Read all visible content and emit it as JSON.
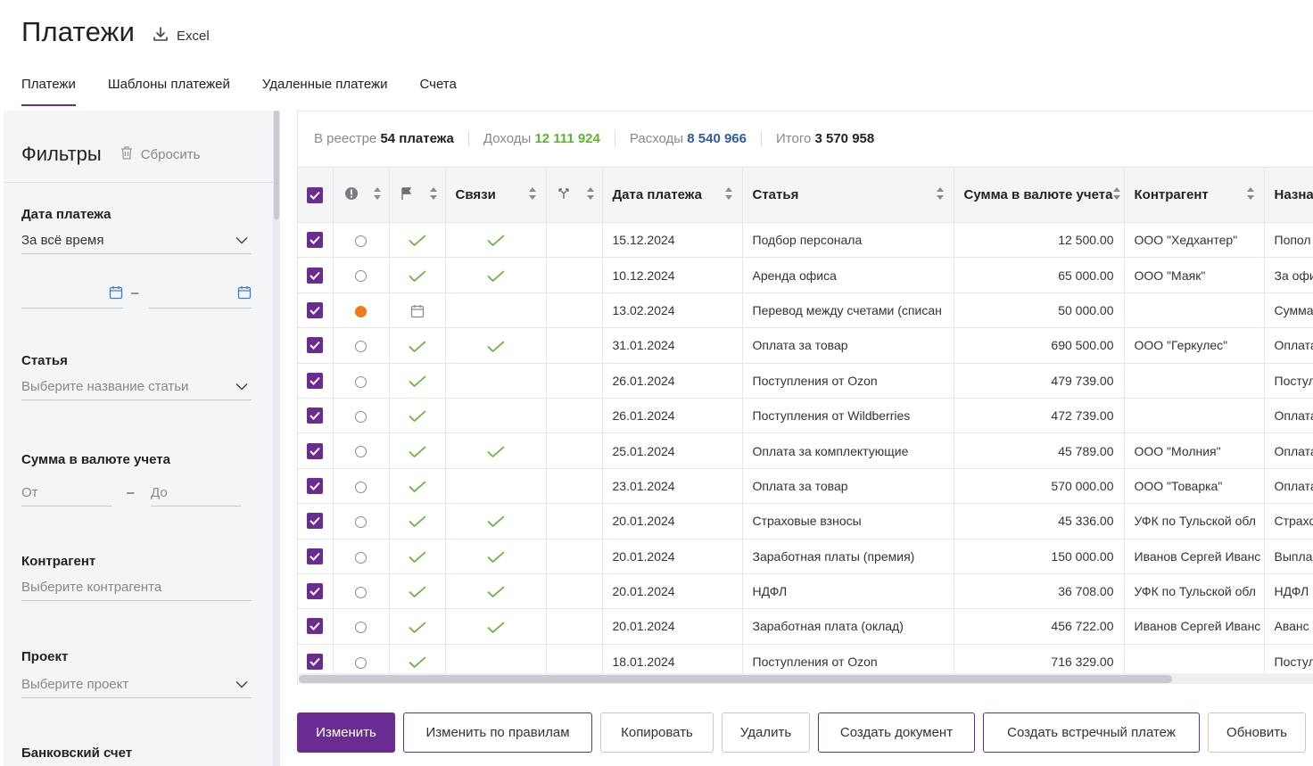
{
  "header": {
    "title": "Платежи",
    "excel_label": "Excel"
  },
  "tabs": [
    {
      "label": "Платежи",
      "active": true
    },
    {
      "label": "Шаблоны платежей",
      "active": false
    },
    {
      "label": "Удаленные платежи",
      "active": false
    },
    {
      "label": "Счета",
      "active": false
    }
  ],
  "filters": {
    "title": "Фильтры",
    "reset_label": "Сбросить",
    "date_label": "Дата платежа",
    "date_select": "За всё время",
    "date_dash": "–",
    "article_label": "Статья",
    "article_placeholder": "Выберите название статьи",
    "amount_label": "Сумма в валюте учета",
    "amount_from": "От",
    "amount_dash": "–",
    "amount_to": "До",
    "counterparty_label": "Контрагент",
    "counterparty_placeholder": "Выберите контрагента",
    "project_label": "Проект",
    "project_placeholder": "Выберите проект",
    "bank_label": "Банковский счет"
  },
  "summary": {
    "registry_label": "В реестре",
    "registry_value": "54 платежа",
    "income_label": "Доходы",
    "income_value": "12 111 924",
    "expense_label": "Расходы",
    "expense_value": "8 540 966",
    "total_label": "Итого",
    "total_value": "3 570 958"
  },
  "table": {
    "columns": {
      "links": "Связи",
      "date": "Дата платежа",
      "article": "Статья",
      "amount": "Сумма в валюте учета",
      "counterparty": "Контрагент",
      "purpose": "Назна"
    },
    "rows": [
      {
        "status": "radio",
        "flag": "check",
        "links": "check",
        "date": "15.12.2024",
        "article": "Подбор персонала",
        "amount": "12 500.00",
        "amount_type": "blue",
        "counterparty": "ООО \"Хедхантер\"",
        "purpose": "Попол"
      },
      {
        "status": "radio",
        "flag": "check",
        "links": "check",
        "date": "10.12.2024",
        "article": "Аренда офиса",
        "amount": "65 000.00",
        "amount_type": "blue",
        "counterparty": "ООО \"Маяк\"",
        "purpose": "За офи"
      },
      {
        "status": "orange",
        "flag": "calendar",
        "links": "",
        "date": "13.02.2024",
        "article": "Перевод между счетами (списан",
        "amount": "50 000.00",
        "amount_type": "blue",
        "counterparty": "",
        "purpose": "Сумма"
      },
      {
        "status": "radio",
        "flag": "check",
        "links": "check",
        "date": "31.01.2024",
        "article": "Оплата за товар",
        "amount": "690 500.00",
        "amount_type": "blue",
        "counterparty": "ООО \"Геркулес\"",
        "purpose": "Оплата"
      },
      {
        "status": "radio",
        "flag": "check",
        "links": "",
        "date": "26.01.2024",
        "article": "Поступления от Ozon",
        "amount": "479 739.00",
        "amount_type": "green",
        "counterparty": "",
        "purpose": "Постул"
      },
      {
        "status": "radio",
        "flag": "check",
        "links": "",
        "date": "26.01.2024",
        "article": "Поступления от Wildberries",
        "amount": "472 739.00",
        "amount_type": "green",
        "counterparty": "",
        "purpose": "Оплата"
      },
      {
        "status": "radio",
        "flag": "check",
        "links": "check",
        "date": "25.01.2024",
        "article": "Оплата за комплектующие",
        "amount": "45 789.00",
        "amount_type": "blue",
        "counterparty": "ООО \"Молния\"",
        "purpose": "Оплата"
      },
      {
        "status": "radio",
        "flag": "check",
        "links": "",
        "date": "23.01.2024",
        "article": "Оплата за товар",
        "amount": "570 000.00",
        "amount_type": "blue",
        "counterparty": "ООО \"Товарка\"",
        "purpose": "Оплата"
      },
      {
        "status": "radio",
        "flag": "check",
        "links": "check",
        "date": "20.01.2024",
        "article": "Страховые взносы",
        "amount": "45 336.00",
        "amount_type": "blue",
        "counterparty": "УФК по Тульской обл",
        "purpose": "Страхо"
      },
      {
        "status": "radio",
        "flag": "check",
        "links": "check",
        "date": "20.01.2024",
        "article": "Заработная платы (премия)",
        "amount": "150 000.00",
        "amount_type": "blue",
        "counterparty": "Иванов Сергей Иванс",
        "purpose": "Выпла"
      },
      {
        "status": "radio",
        "flag": "check",
        "links": "check",
        "date": "20.01.2024",
        "article": "НДФЛ",
        "amount": "36 708.00",
        "amount_type": "blue",
        "counterparty": "УФК по Тульской обл",
        "purpose": "НДФЛ"
      },
      {
        "status": "radio",
        "flag": "check",
        "links": "check",
        "date": "20.01.2024",
        "article": "Заработная плата (оклад)",
        "amount": "456 722.00",
        "amount_type": "blue",
        "counterparty": "Иванов Сергей Иванс",
        "purpose": "Аванс"
      },
      {
        "status": "radio",
        "flag": "check",
        "links": "",
        "date": "18.01.2024",
        "article": "Поступления от Ozon",
        "amount": "716 329.00",
        "amount_type": "green",
        "counterparty": "",
        "purpose": "Постул"
      }
    ]
  },
  "actions": {
    "edit": "Изменить",
    "edit_rules": "Изменить по правилам",
    "copy": "Копировать",
    "delete": "Удалить",
    "create_doc": "Создать документ",
    "create_counter": "Создать встречный платеж",
    "refresh": "Обновить"
  },
  "colors": {
    "accent": "#6a2c91",
    "income": "#5db431",
    "expense": "#2d5ea3",
    "status_orange": "#f07a1a"
  }
}
